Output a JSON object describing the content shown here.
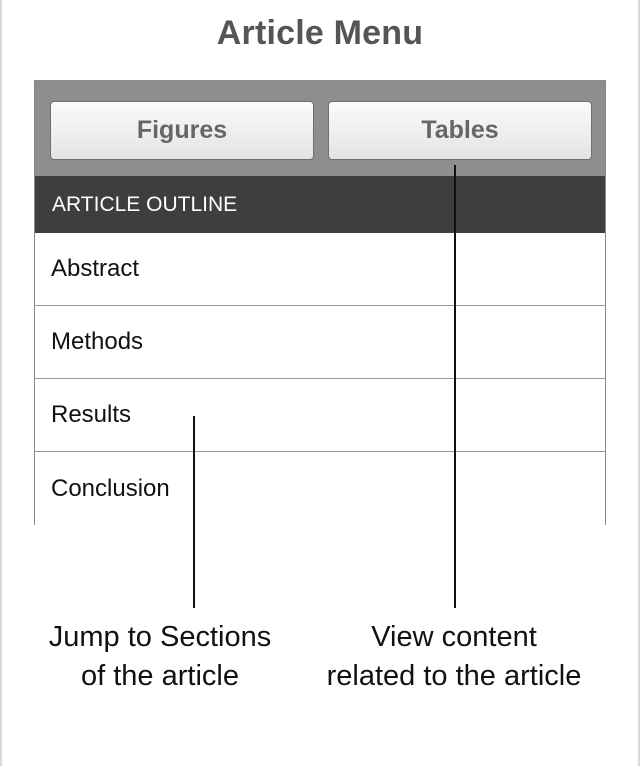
{
  "page": {
    "title": "Article Menu"
  },
  "toolbar": {
    "figures_label": "Figures",
    "tables_label": "Tables"
  },
  "outline": {
    "header": "ARTICLE OUTLINE",
    "items": [
      "Abstract",
      "Methods",
      "Results",
      "Conclusion"
    ]
  },
  "callouts": {
    "sections": {
      "line1": "Jump to Sections",
      "line2": "of the article"
    },
    "tables": {
      "line1": "View content",
      "line2": "related to the article"
    }
  }
}
